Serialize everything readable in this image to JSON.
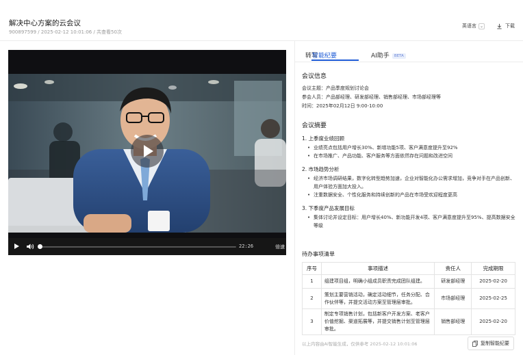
{
  "header": {
    "title": "解决中心方案的云会议",
    "meta": "900897599 / 2025-02-12 10:01:06 / 共查看50次",
    "lang_label": "英语言",
    "download_label": "下载"
  },
  "video": {
    "time": "22:26",
    "speed_label": "倍速",
    "progress": 0
  },
  "tabs": [
    {
      "label": "转写"
    },
    {
      "label": "智能纪要"
    },
    {
      "label": "AI助手"
    }
  ],
  "beta_label": "BETA",
  "meeting_info": {
    "heading": "会议信息",
    "topic": "会议主题：产品季度规划讨论会",
    "participants": "参会人员：产品部经理、研发部经理、销售部经理、市场部经理等",
    "time": "时间：2025年02月12日 9:00-10:00"
  },
  "summary": {
    "heading": "会议摘要",
    "sections": [
      {
        "title": "1. 上季度业绩回顾",
        "bullets": [
          "业绩亮点包括用户增长30%、新增功能5项、客户满意度提升至92%",
          "在市场推广、产品功能、客户服务等方面依然存在问题和改进空间"
        ]
      },
      {
        "title": "2. 市场趋势分析",
        "bullets": [
          "经济市场调研结果，数字化转型趋势加速，企业对智能化办公需求增加，竞争对手在产品创新、用户体验方面加大投入。",
          "注重数据安全、个性化服务和持续创新的产品在市场受欢迎程度更高"
        ]
      },
      {
        "title": "3. 下季度产品发展目标",
        "bullets": [
          "集体讨论并设定目标：用户增长40%、新功能开发4项、客户满意度提升至95%、提高数据安全等级"
        ]
      }
    ]
  },
  "todo": {
    "heading": "待办事项清单",
    "columns": [
      "序号",
      "事项描述",
      "责任人",
      "完成期限"
    ],
    "rows": [
      [
        "1",
        "组建项目组，明确小组成员职责完成团队组建。",
        "研发部经理",
        "2025-02-20"
      ],
      [
        "2",
        "策划主要营销活动，确定活动细节，任务分配、合作伙伴等，并提交活动方案至管理层审批。",
        "市场部经理",
        "2025-02-25"
      ],
      [
        "3",
        "制定专项销售计划，包括新客户开发方案、老客户价值挖掘、渠道拓展等，并提交销售计划至管理层审批。",
        "销售部经理",
        "2025-02-20"
      ]
    ]
  },
  "footer": {
    "note": "以上内容由AI智能生成，仅供参考 2025-02-12 10:01:06",
    "copy_label": "复制智能纪要"
  }
}
